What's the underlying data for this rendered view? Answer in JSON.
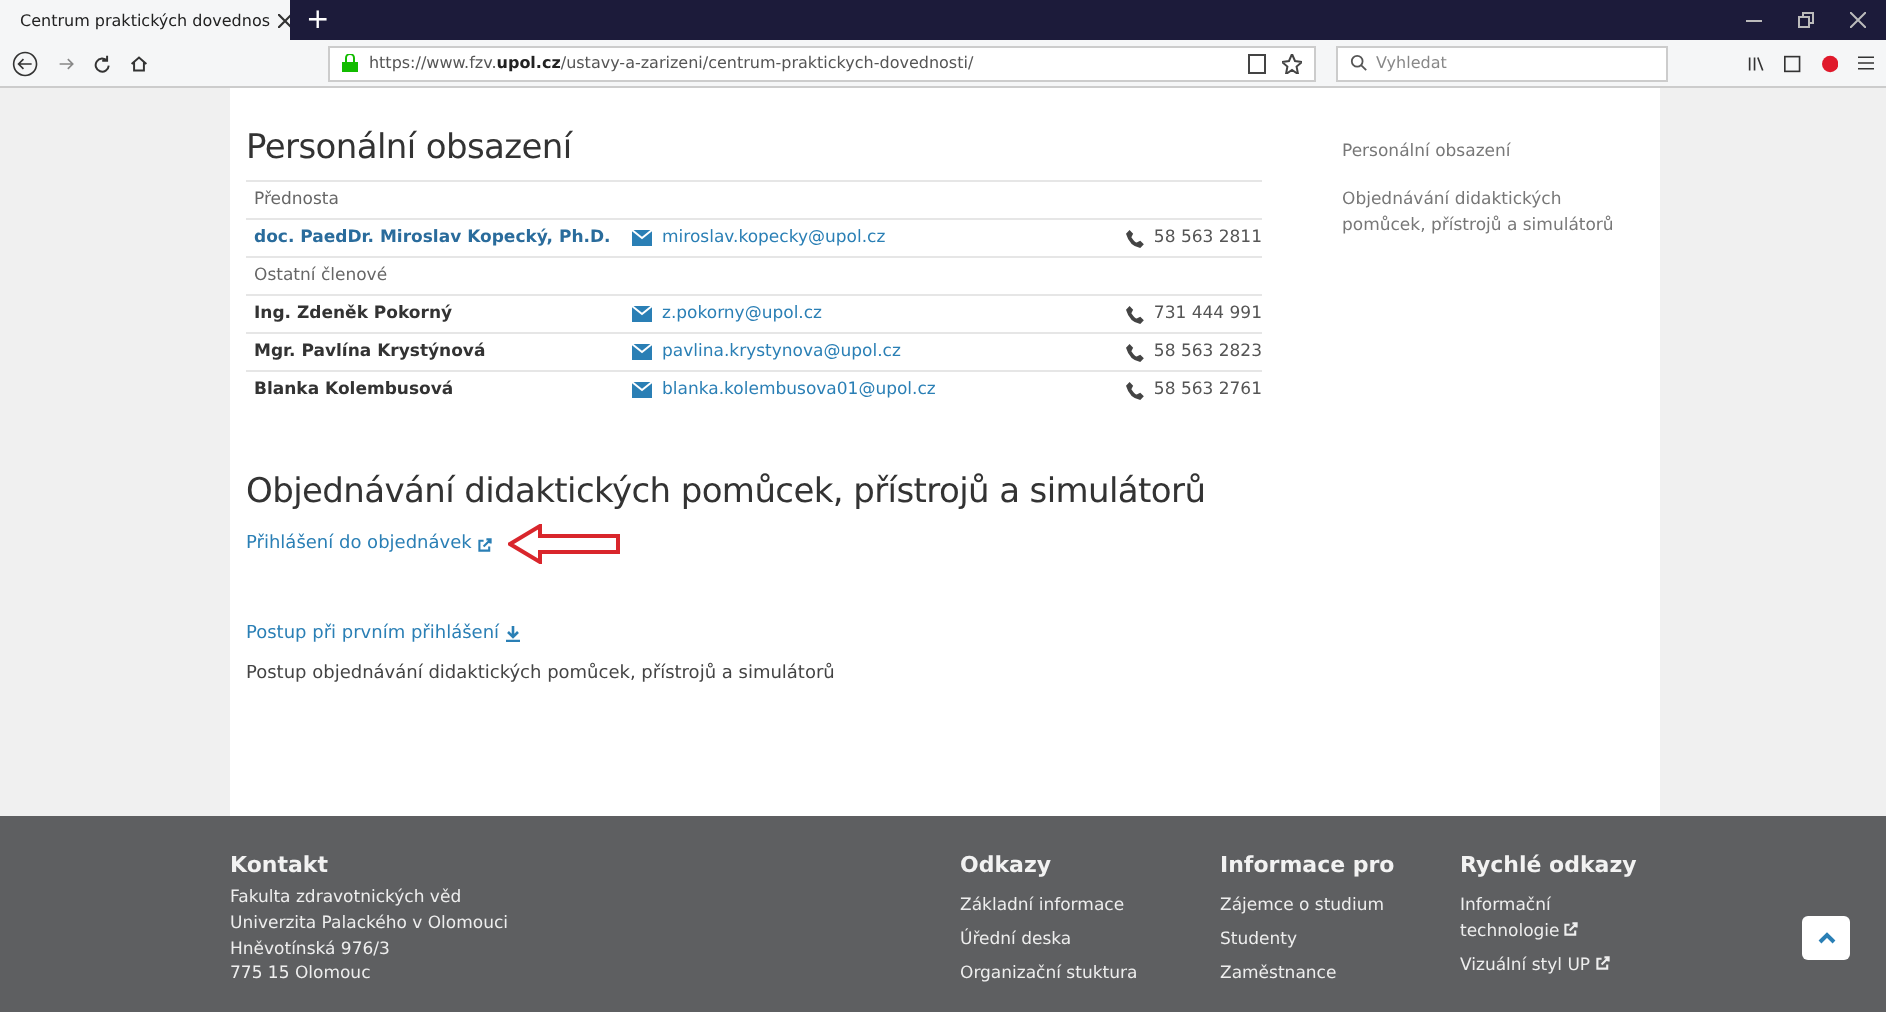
{
  "browser": {
    "tab_title": "Centrum praktických dovednos",
    "new_tab": "+",
    "url_prefix": "https://www.fzv.",
    "url_domain": "upol.cz",
    "url_path": "/ustavy-a-zarizeni/centrum-praktickych-dovednosti/",
    "search_placeholder": "Vyhledat"
  },
  "personnel": {
    "heading": "Personální obsazení",
    "rows": [
      {
        "kind": "group",
        "label": "Přednosta"
      },
      {
        "kind": "person",
        "name": "doc. PaedDr. Miroslav Kopecký, Ph.D.",
        "link": true,
        "email": "miroslav.kopecky@upol.cz",
        "phone": "58 563 2811"
      },
      {
        "kind": "group",
        "label": "Ostatní členové"
      },
      {
        "kind": "person",
        "name": "Ing. Zdeněk Pokorný",
        "link": false,
        "email": "z.pokorny@upol.cz",
        "phone": "731 444 991"
      },
      {
        "kind": "person",
        "name": "Mgr. Pavlína Krystýnová",
        "link": false,
        "email": "pavlina.krystynova@upol.cz",
        "phone": "58 563 2823"
      },
      {
        "kind": "person",
        "name": "Blanka Kolembusová",
        "link": false,
        "email": "blanka.kolembusova01@upol.cz",
        "phone": "58 563 2761"
      }
    ]
  },
  "ordering": {
    "heading": "Objednávání didaktických pomůcek, přístrojů a simulátorů",
    "login_link": "Přihlášení do objednávek",
    "first_login_link": "Postup při prvním přihlášení",
    "description": "Postup objednávání didaktických pomůcek, přístrojů a simulátorů"
  },
  "sidebar": {
    "items": [
      "Personální obsazení",
      "Objednávání didaktických pomůcek, přístrojů a simulátorů"
    ]
  },
  "footer": {
    "columns": [
      {
        "heading": "Kontakt",
        "items": [
          {
            "text": "Fakulta zdravotnických věd",
            "external": false
          },
          {
            "text": "Univerzita Palackého v Olomouci",
            "external": false
          },
          {
            "text": "Hněvotínská 976/3",
            "external": false
          },
          {
            "text": "775 15 Olomouc",
            "external": false
          }
        ]
      },
      {
        "heading": "Odkazy",
        "items": [
          {
            "text": "Základní informace",
            "external": false
          },
          {
            "text": "Úřední deska",
            "external": false
          },
          {
            "text": "Organizační stuktura",
            "external": false
          }
        ]
      },
      {
        "heading": "Informace pro",
        "items": [
          {
            "text": "Zájemce o studium",
            "external": false
          },
          {
            "text": "Studenty",
            "external": false
          },
          {
            "text": "Zaměstnance",
            "external": false
          }
        ]
      },
      {
        "heading": "Rychlé odkazy",
        "items": [
          {
            "text": "Informační technologie",
            "external": true
          },
          {
            "text": "Vizuální styl UP",
            "external": true
          }
        ]
      }
    ]
  }
}
